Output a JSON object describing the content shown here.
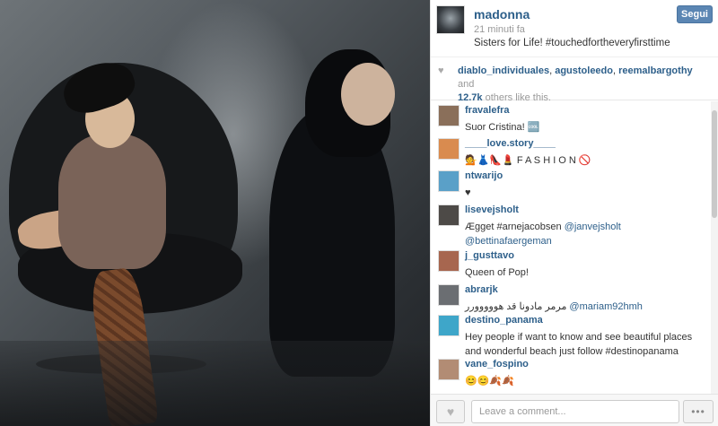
{
  "post": {
    "username": "madonna",
    "time": "21 minuti fa",
    "caption": "Sisters for Life! #touchedfortheveryfirsttime",
    "follow_label": "Segui"
  },
  "likes": {
    "users": [
      "diablo_individuales",
      "agustoleedo",
      "reemalbargothy"
    ],
    "sep1": ", ",
    "sep2": ", ",
    "and_text": " and",
    "count": "12.7k",
    "others_text": " others like this."
  },
  "comments": [
    {
      "user": "fravalefra",
      "text": "Suor Cristina! 🆒",
      "avatar_color": "#8a6f5a"
    },
    {
      "user": "____love.story____",
      "text": "💁👗👠💄 F A S H I O N 🚫",
      "avatar_color": "#d98b4f"
    },
    {
      "user": "ntwarijo",
      "text": "♥",
      "avatar_color": "#5aa0c8"
    },
    {
      "user": "lisevejsholt",
      "text_prefix": "Ægget #arnejacobsen ",
      "mention1": "@janvejsholt",
      "mention2": "@bettinafaergeman",
      "avatar_color": "#4d4a47"
    },
    {
      "user": "j_gusttavo",
      "text": "Queen of Pop!",
      "avatar_color": "#a7664f"
    },
    {
      "user": "abrarjk",
      "text_prefix": "مرمر مادونا قد هووووورر ",
      "mention": "@mariam92hmh",
      "avatar_color": "#6b6e72"
    },
    {
      "user": "destino_panama",
      "text": "Hey people if want to know and see beautiful places and wonderful beach just follow #destinopanama",
      "avatar_color": "#3ea6c9"
    },
    {
      "user": "vane_fospino",
      "text": "😊😊🍂🍂",
      "avatar_color": "#b28c74"
    }
  ],
  "footer": {
    "comment_placeholder": "Leave a comment...",
    "more_label": "•••"
  }
}
